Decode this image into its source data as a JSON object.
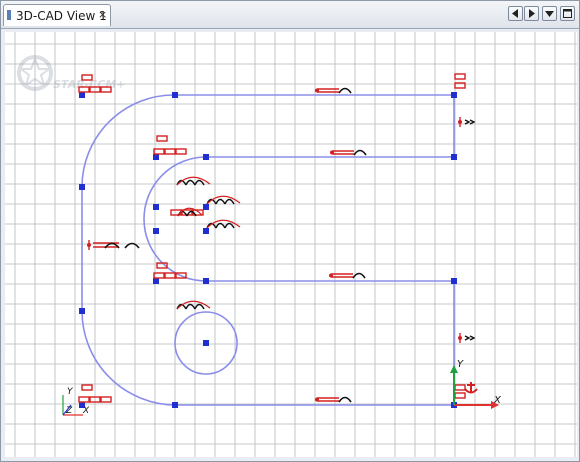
{
  "window": {
    "tab": {
      "title": "3D-CAD View 1",
      "close_glyph": "×"
    },
    "nav_icons": [
      "nav-left-icon",
      "nav-right-icon",
      "dropdown-arrow-icon",
      "maximize-icon"
    ]
  },
  "watermark": {
    "text": "STAR-CCM+"
  },
  "axes": {
    "triad": {
      "x_label": "X",
      "y_label": "Y",
      "z_label": "Z"
    },
    "sketch_origin": {
      "x_label": "X",
      "y_label": "Y"
    }
  },
  "colors": {
    "grid": "#b5b8bd",
    "grid_background": "#ffffff",
    "sketch_line": "#8a8ee8",
    "sketch_point": "#1f2fd0",
    "constraint_red": "#d42020",
    "constraint_black": "#111111",
    "axis_x": "#e03030",
    "axis_y": "#20a040",
    "axis_z": "#2040e0"
  }
}
